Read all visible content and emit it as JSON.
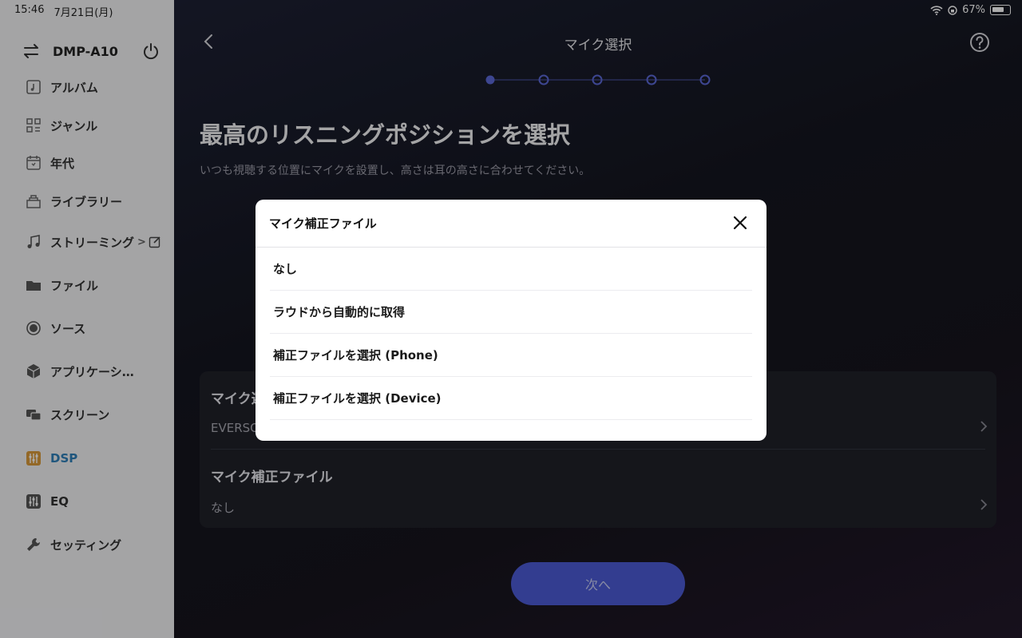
{
  "status": {
    "time": "15:46",
    "date": "7月21日(月)",
    "battery": "67%"
  },
  "sidebar": {
    "device_name": "DMP-A10",
    "items": [
      {
        "label": "アルバム",
        "icon": "album-icon"
      },
      {
        "label": "ジャンル",
        "icon": "genre-icon"
      },
      {
        "label": "年代",
        "icon": "calendar-icon"
      },
      {
        "label": "ライブラリー",
        "icon": "library-icon"
      },
      {
        "label": "ストリーミング",
        "icon": "music-note-icon"
      },
      {
        "label": "ファイル",
        "icon": "folder-icon"
      },
      {
        "label": "ソース",
        "icon": "source-icon"
      },
      {
        "label": "アプリケーシ…",
        "icon": "cube-icon"
      },
      {
        "label": "スクリーン",
        "icon": "screen-icon"
      },
      {
        "label": "DSP",
        "icon": "dsp-icon",
        "active": true
      },
      {
        "label": "EQ",
        "icon": "eq-icon"
      },
      {
        "label": "セッティング",
        "icon": "wrench-icon"
      }
    ],
    "streaming_chevron": ">"
  },
  "main": {
    "title": "マイク選択",
    "steps": {
      "total": 5,
      "current": 1
    },
    "heading": "最高のリスニングポジションを選択",
    "subtext": "いつも視聴する位置にマイクを設置し、高さは耳の高さに合わせてください。",
    "card": {
      "rows": [
        {
          "label": "マイク選",
          "value": "EVERSO"
        },
        {
          "label": "マイク補正ファイル",
          "value": "なし"
        }
      ]
    },
    "next_label": "次へ"
  },
  "modal": {
    "title": "マイク補正ファイル",
    "options": [
      "なし",
      "ラウドから自動的に取得",
      "補正ファイルを選択 (Phone)",
      "補正ファイルを選択 (Device)"
    ]
  },
  "colors": {
    "accent": "#4c5bd4",
    "active_nav": "#2f7fb8",
    "step": "#5b68d6"
  }
}
